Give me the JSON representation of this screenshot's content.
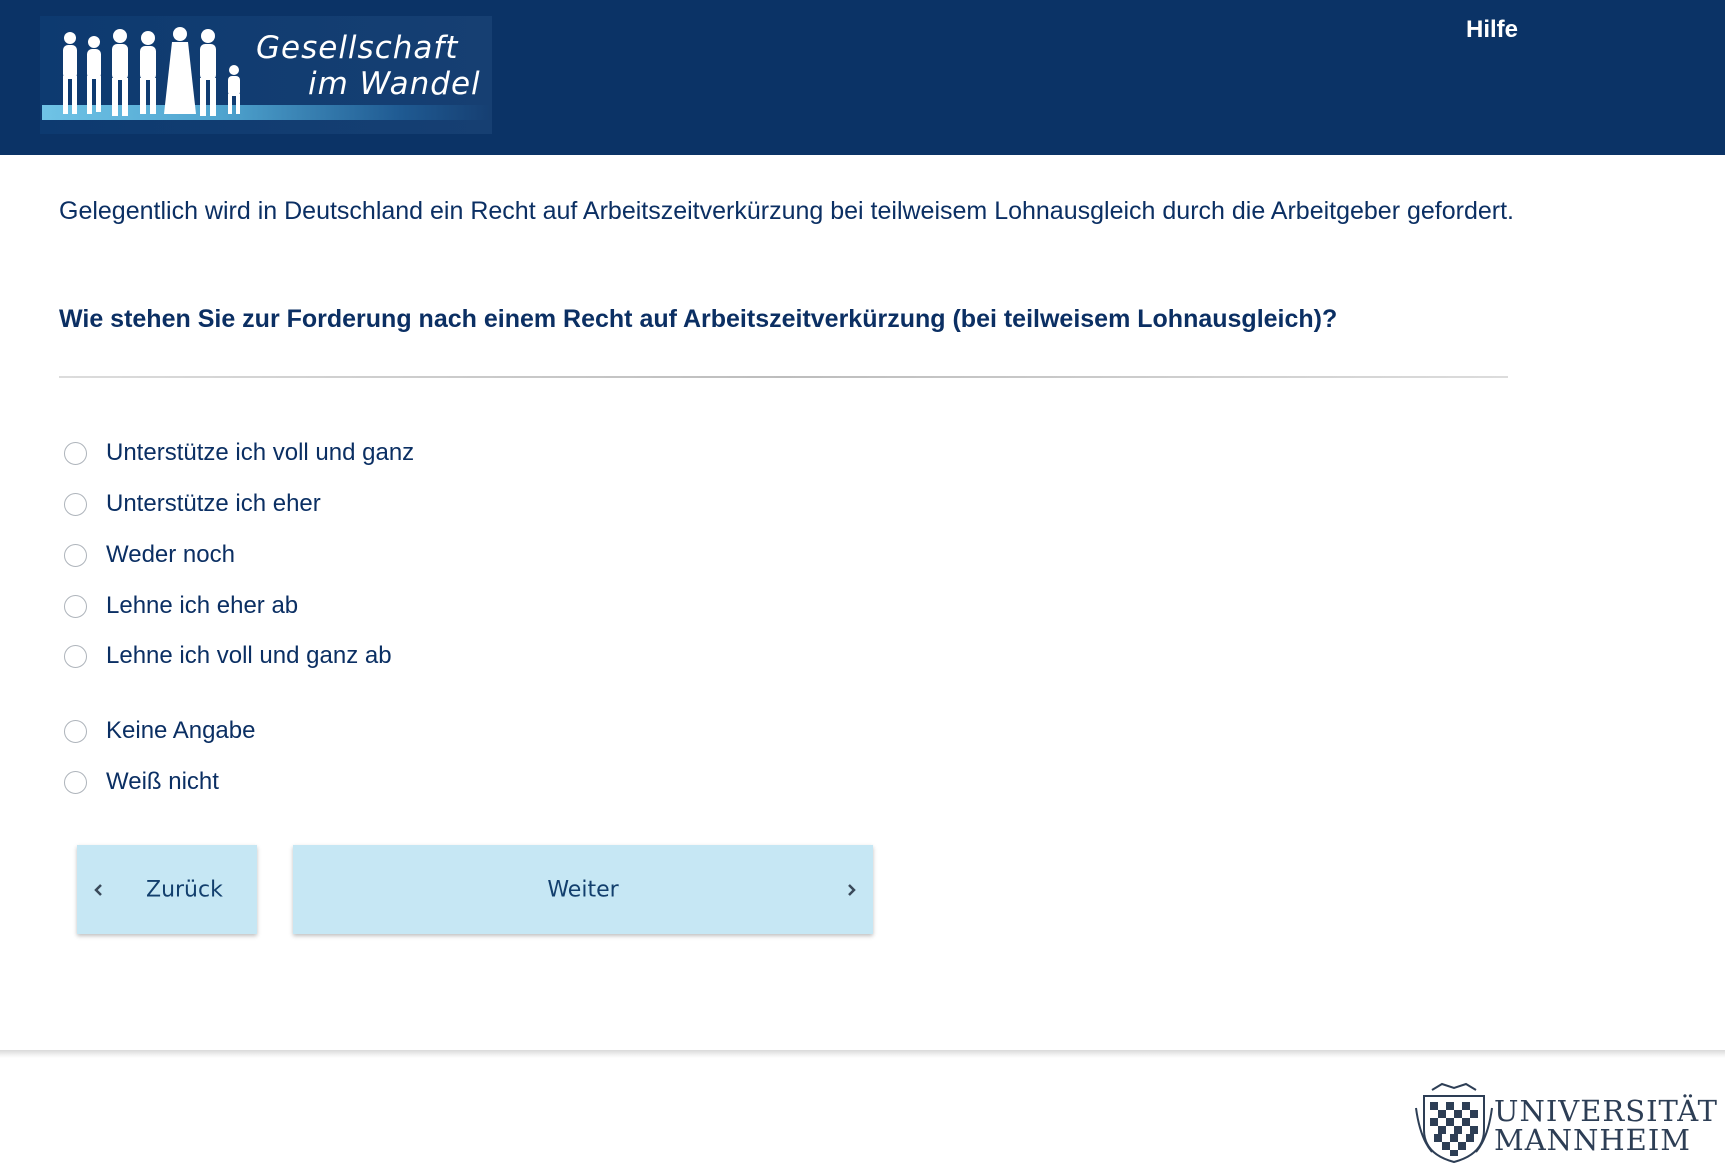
{
  "header": {
    "logo_line1": "Gesellschaft",
    "logo_line2": "im Wandel",
    "help_label": "Hilfe"
  },
  "intro_text": "Gelegentlich wird in Deutschland ein Recht auf Arbeitszeitverkürzung bei teilweisem Lohnausgleich durch die Arbeitgeber gefordert.",
  "question_text": "Wie stehen Sie zur Forderung nach einem Recht auf Arbeitszeitverkürzung (bei teilweisem Lohnausgleich)?",
  "options": [
    {
      "label": "Unterstütze ich voll und ganz",
      "selected": false
    },
    {
      "label": "Unterstütze ich eher",
      "selected": false
    },
    {
      "label": "Weder noch",
      "selected": false
    },
    {
      "label": "Lehne ich eher ab",
      "selected": false
    },
    {
      "label": "Lehne ich voll und ganz ab",
      "selected": false
    },
    {
      "label": "Keine Angabe",
      "selected": false
    },
    {
      "label": "Weiß nicht",
      "selected": false
    }
  ],
  "nav": {
    "back_label": "Zurück",
    "next_label": "Weiter"
  },
  "footer": {
    "university_line1": "UNIVERSITÄT",
    "university_line2": "MANNHEIM"
  },
  "colors": {
    "header_bg": "#0b3366",
    "text": "#0b2f63",
    "button_bg": "#c6e7f4"
  }
}
